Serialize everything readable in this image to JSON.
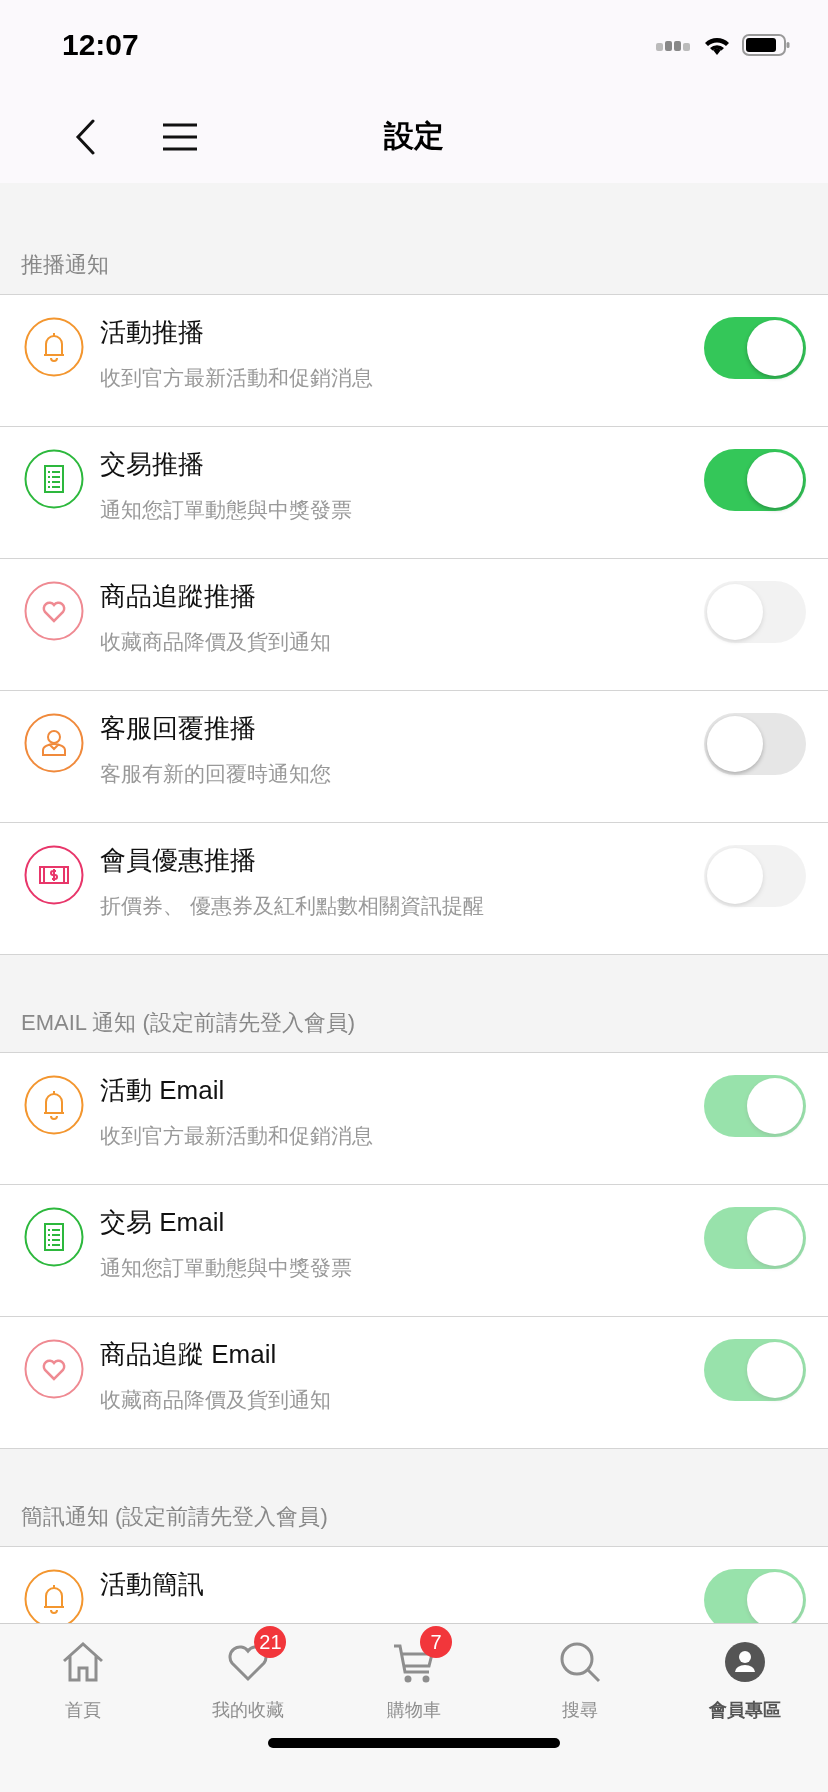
{
  "status_bar": {
    "time": "12:07"
  },
  "nav_bar": {
    "title": "設定"
  },
  "sections": [
    {
      "header": "推播通知",
      "items": [
        {
          "kind": "bell",
          "title": "活動推播",
          "subtitle": "收到官方最新活動和促銷消息",
          "on": true,
          "disabled": false
        },
        {
          "kind": "receipt",
          "title": "交易推播",
          "subtitle": "通知您訂單動態與中獎發票",
          "on": true,
          "disabled": false
        },
        {
          "kind": "heart",
          "title": "商品追蹤推播",
          "subtitle": "收藏商品降價及貨到通知",
          "on": false,
          "disabled": true
        },
        {
          "kind": "agent",
          "title": "客服回覆推播",
          "subtitle": "客服有新的回覆時通知您",
          "on": false,
          "disabled": false
        },
        {
          "kind": "coupon",
          "title": "會員優惠推播",
          "subtitle": "折價券、 優惠券及紅利點數相關資訊提醒",
          "on": false,
          "disabled": true
        }
      ]
    },
    {
      "header": "EMAIL 通知 (設定前請先登入會員)",
      "items": [
        {
          "kind": "bell",
          "title": "活動 Email",
          "subtitle": "收到官方最新活動和促銷消息",
          "on": true,
          "disabled": true
        },
        {
          "kind": "receipt",
          "title": "交易 Email",
          "subtitle": "通知您訂單動態與中獎發票",
          "on": true,
          "disabled": true
        },
        {
          "kind": "heart",
          "title": "商品追蹤 Email",
          "subtitle": "收藏商品降價及貨到通知",
          "on": true,
          "disabled": true
        }
      ]
    },
    {
      "header": "簡訊通知 (設定前請先登入會員)",
      "items": [
        {
          "kind": "bell",
          "title": "活動簡訊",
          "on": true,
          "disabled": true
        }
      ]
    }
  ],
  "tab_bar": [
    {
      "kind": "home",
      "label": "首頁",
      "selected": false
    },
    {
      "kind": "heart",
      "label": "我的收藏",
      "badge": "21",
      "selected": false
    },
    {
      "kind": "cart",
      "label": "購物車",
      "badge": "7",
      "selected": false
    },
    {
      "kind": "search",
      "label": "搜尋",
      "selected": false
    },
    {
      "kind": "person",
      "label": "會員專區",
      "selected": true
    }
  ]
}
